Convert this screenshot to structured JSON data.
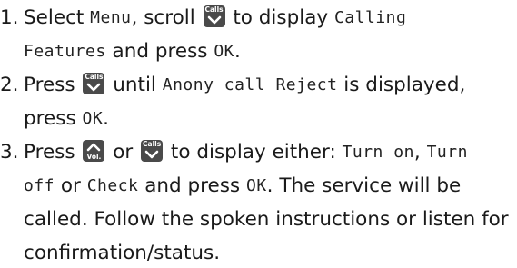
{
  "steps": [
    {
      "number": "1.",
      "t1": "Select ",
      "lcd1": "Menu",
      "t2": ", scroll ",
      "t3": " to display ",
      "lcd2": "Calling",
      "lcd3": "Features",
      "t4": " and press ",
      "lcd4": "OK",
      "t5": "."
    },
    {
      "number": "2.",
      "t1": "Press ",
      "t2": " until ",
      "lcd1": "Anony call Reject",
      "t3": " is displayed,",
      "t4": "press ",
      "lcd2": "OK",
      "t5": "."
    },
    {
      "number": "3.",
      "t1": "Press ",
      "t2": " or ",
      "t3": " to display either: ",
      "lcd1": "Turn on",
      "t4": ", ",
      "lcd2": "Turn",
      "lcd3": "off",
      "t5": " or ",
      "lcd4": "Check",
      "t6": " and press ",
      "lcd5": "OK",
      "t7": ". The service will be",
      "line3": "called. Follow the spoken instructions or listen for",
      "line4": "confirmation/status."
    }
  ],
  "keys": {
    "calls_label": "Calls",
    "vol_label": "Vol."
  },
  "colors": {
    "text": "#1a1a1a",
    "key_bg": "#4a4a4a",
    "key_fg": "#ffffff"
  }
}
